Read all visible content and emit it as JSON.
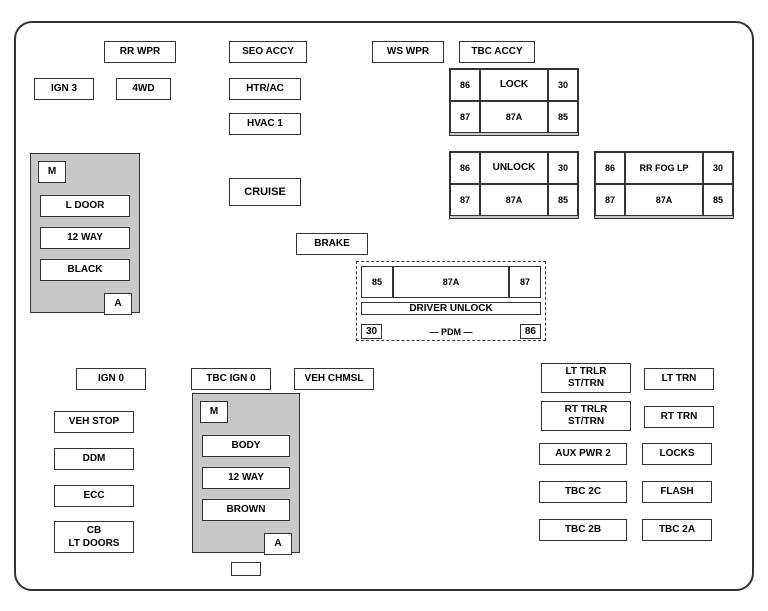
{
  "boxes": {
    "rr_wpr": "RR WPR",
    "seo_accy": "SEO ACCY",
    "ws_wpr": "WS WPR",
    "tbc_accy": "TBC ACCY",
    "ign3": "IGN 3",
    "fwd": "4WD",
    "htr_ac": "HTR/AC",
    "hvac1": "HVAC 1",
    "cruise": "CRUISE",
    "brake": "BRAKE",
    "ign0": "IGN 0",
    "tbc_ign0": "TBC IGN 0",
    "veh_chmsl": "VEH CHMSL",
    "veh_stop": "VEH STOP",
    "ddm": "DDM",
    "ecc": "ECC",
    "cb_lt_doors": "CB\nLT DOORS",
    "lt_trlr_st_trn": "LT TRLR\nST/TRN",
    "lt_trn": "LT TRN",
    "rt_trlr_st_trn": "RT TRLR\nST/TRN",
    "rt_trn": "RT TRN",
    "aux_pwr2": "AUX PWR 2",
    "locks": "LOCKS",
    "tbc_2c": "TBC 2C",
    "flash": "FLASH",
    "tbc_2b": "TBC 2B",
    "tbc_2a": "TBC 2A",
    "pdm": "PDM"
  },
  "relay_lock": {
    "r86": "86",
    "r30": "30",
    "label": "LOCK",
    "r87": "87",
    "r87a": "87A",
    "r85": "85"
  },
  "relay_unlock": {
    "r86": "86",
    "r30": "30",
    "label": "UNLOCK",
    "r87": "87",
    "r87a": "87A",
    "r85": "85"
  },
  "relay_rr_fog": {
    "r86": "86",
    "r30": "30",
    "label": "RR FOG LP",
    "r87": "87",
    "r87a": "87A",
    "r85": "85"
  },
  "relay_driver_unlock": {
    "r85": "85",
    "r87a": "87A",
    "r87": "87",
    "label": "DRIVER UNLOCK",
    "r30": "30",
    "r86": "86"
  },
  "ldoor_block": {
    "m": "M",
    "ldoor": "L DOOR",
    "way12": "12 WAY",
    "black": "BLACK",
    "a": "A"
  },
  "body_block": {
    "m": "M",
    "body": "BODY",
    "way12": "12 WAY",
    "brown": "BROWN",
    "a": "A"
  }
}
